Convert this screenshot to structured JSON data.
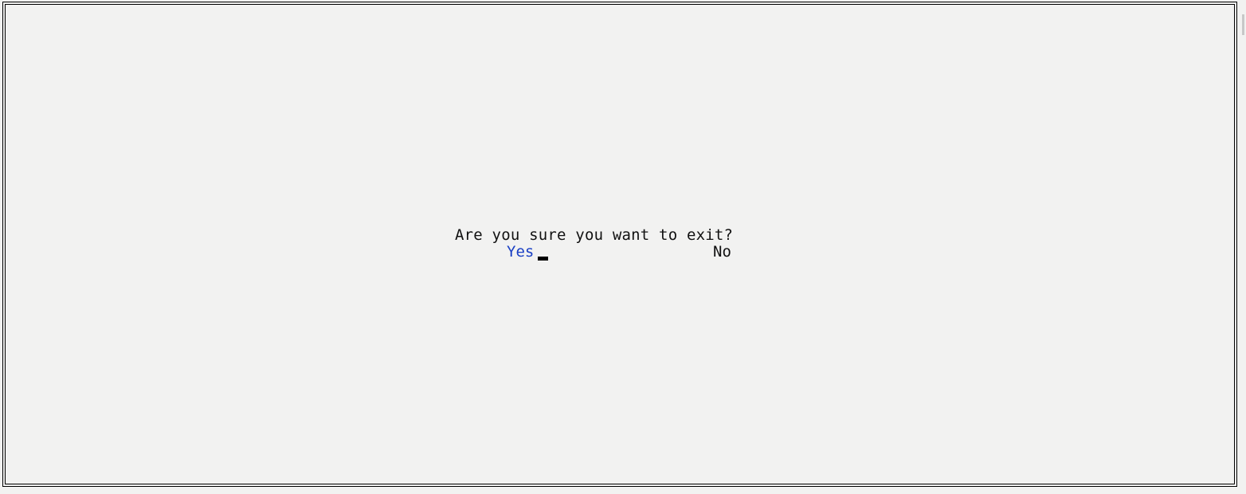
{
  "dialog": {
    "prompt": "Are you sure you want to exit?",
    "options": [
      {
        "label": "Yes",
        "selected": true
      },
      {
        "label": "No",
        "selected": false
      }
    ]
  },
  "colors": {
    "background": "#f2f2f1",
    "text": "#111111",
    "selected_option": "#1a3fc4",
    "border": "#000000"
  }
}
